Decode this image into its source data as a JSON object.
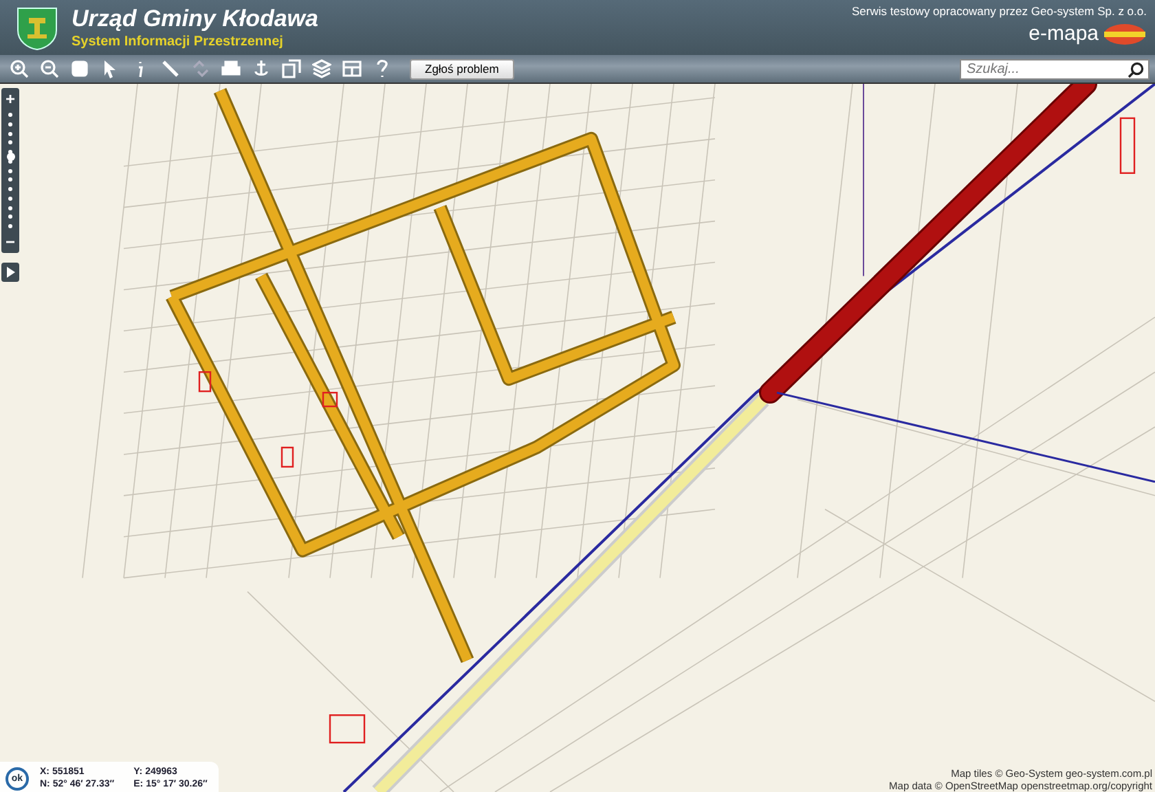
{
  "header": {
    "title": "Urząd Gminy Kłodawa",
    "subtitle": "System Informacji Przestrzennej",
    "service_note": "Serwis testowy opracowany przez Geo-system Sp. z o.o.",
    "brand": "e-mapa"
  },
  "toolbar": {
    "report_button": "Zgłoś problem",
    "search": {
      "placeholder": "Szukaj..."
    }
  },
  "zoom_slider": {
    "plus": "+",
    "minus": "−",
    "level": 0.62
  },
  "coordinates": {
    "status": "ok",
    "x": "X: 551851",
    "y": "Y: 249963",
    "n": "N: 52° 46′ 27.33″",
    "e": "E: 15° 17′ 30.26″"
  },
  "attribution": [
    "Map tiles © Geo-System geo-system.com.pl",
    "Map data © OpenStreetMap openstreetmap.org/copyright"
  ]
}
